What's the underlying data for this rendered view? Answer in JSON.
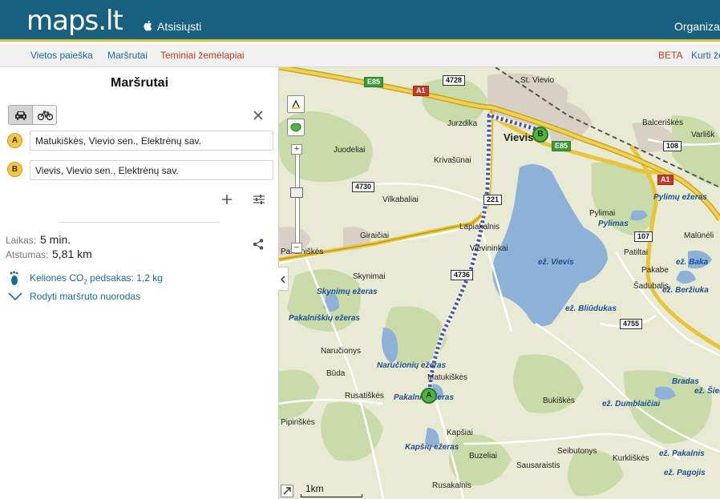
{
  "header": {
    "logo": "maps.lt",
    "download_label": "Atsisiųsti",
    "right_link": "Organiza"
  },
  "nav": {
    "items": [
      "Vietos paieška",
      "Maršrutai",
      "Teminiai žemėlapiai"
    ],
    "beta_label": "BETA",
    "create_label": "Kurti že"
  },
  "sidebar": {
    "title": "Maršrutai",
    "modes": {
      "car_icon": "car-icon",
      "bike_icon": "bicycle-icon",
      "selected": "car"
    },
    "points": [
      {
        "marker": "A",
        "value": "Matukiškės, Vievio sen., Elektrėnų sav."
      },
      {
        "marker": "B",
        "value": "Vievis, Vievio sen., Elektrėnų sav."
      }
    ],
    "time_label": "Laikas:",
    "time_value": "5 min.",
    "distance_label": "Atstumas:",
    "distance_value": "5,81 km",
    "co2_prefix": "Kelionės CO",
    "co2_sub": "2",
    "co2_suffix": " pėdsakas: 1,2 kg",
    "directions_link": "Rodyti maršruto nuorodas"
  },
  "map": {
    "colors": {
      "land": "#e9ead4",
      "water": "#8eb1d8",
      "forest": "#c8dba8",
      "route": "#4b53b0",
      "highway": "#e8c438",
      "marker": "#53b044"
    },
    "towns": [
      "Vievis"
    ],
    "places": [
      "Jurzdika",
      "Juodeliai",
      "Krivašūnai",
      "Vilkabaliai",
      "Lapiakalnis",
      "Vievininkai",
      "Giraičiai",
      "Pakalniškės",
      "Skynimai",
      "Naručionys",
      "Būda",
      "Rusatiškės",
      "Matukiškės",
      "Pipiriškės",
      "Kapšiai",
      "Buzeliai",
      "Sausaraistis",
      "Rusakalnis",
      "Bukiškės",
      "Seibutonys",
      "Kurkliškės",
      "Pylimai",
      "Patiltai",
      "Pakabe",
      "Šadubalis",
      "Balceriškės",
      "Varlišk",
      "Malūnėli",
      "St. Vievio",
      "Organizac"
    ],
    "waters": [
      "Skynimų ežeras",
      "Pakalniškių ežeras",
      "Naručionių ežeras",
      "Pakalnių ežeras",
      "Kapšių ežeras",
      "ež. Vievis",
      "ež. Bliūdukas",
      "Pylimų ežeras",
      "Pylimas",
      "ež. Baka",
      "ež. Beržiuka",
      "ež. Dumblaičiai",
      "ež. Pakalnis",
      "ež. Pagojis",
      "ež. Šieme",
      "Bradas"
    ],
    "roads": {
      "e85_a": "E85",
      "a1_a": "A1",
      "r4728": "4728",
      "e85_b": "E85",
      "r108": "108",
      "a1_b": "A1",
      "r4730": "4730",
      "r221": "221",
      "r107": "107",
      "r4736": "4736",
      "r4755": "4755"
    },
    "markers": [
      "A",
      "B"
    ],
    "scale_label": "1km",
    "zoom_in": "+",
    "zoom_out": "−"
  }
}
